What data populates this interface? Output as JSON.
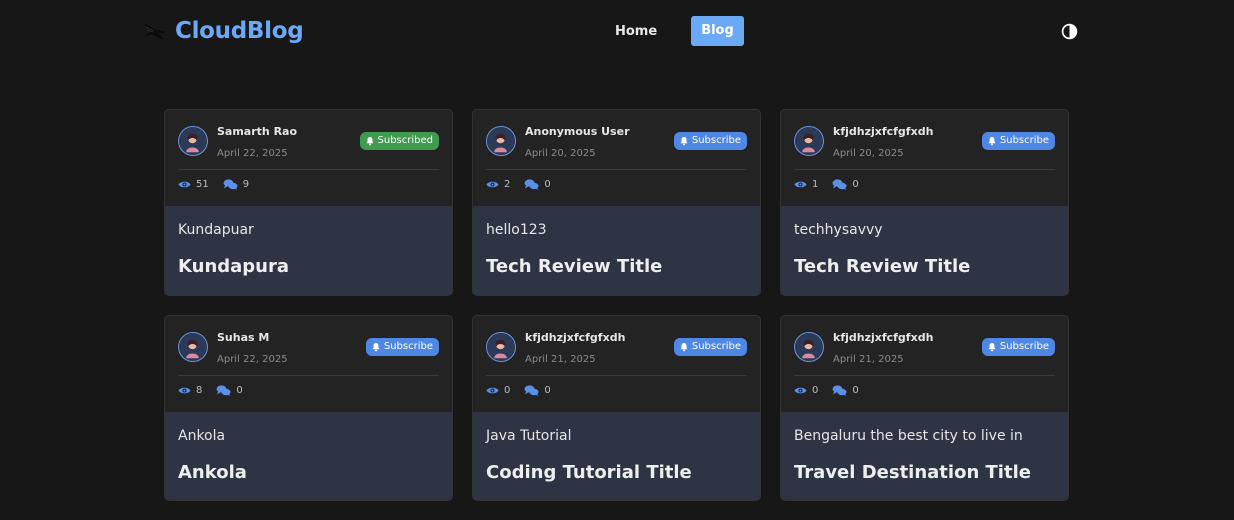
{
  "brand": {
    "name": "CloudBlog",
    "logo_icon": "bird-logo-icon"
  },
  "nav": {
    "home_label": "Home",
    "blog_label": "Blog",
    "theme_icon": "theme-toggle-icon"
  },
  "colors": {
    "accent": "#6aa9f5",
    "subscribe": "#4f87e5",
    "subscribed": "#3f9c4e",
    "card_body": "#2e3443",
    "background": "#171717"
  },
  "posts": [
    {
      "author": "Samarth Rao",
      "date": "April 22, 2025",
      "subscribe_label": "Subscribed",
      "subscribed": true,
      "views": "51",
      "comments": "9",
      "subtitle": "Kundapuar",
      "title": "Kundapura"
    },
    {
      "author": "Anonymous User",
      "date": "April 20, 2025",
      "subscribe_label": "Subscribe",
      "subscribed": false,
      "views": "2",
      "comments": "0",
      "subtitle": "hello123",
      "title": "Tech Review Title"
    },
    {
      "author": "kfjdhzjxfcfgfxdh",
      "date": "April 20, 2025",
      "subscribe_label": "Subscribe",
      "subscribed": false,
      "views": "1",
      "comments": "0",
      "subtitle": "techhysavvy",
      "title": "Tech Review Title"
    },
    {
      "author": "Suhas M",
      "date": "April 22, 2025",
      "subscribe_label": "Subscribe",
      "subscribed": false,
      "views": "8",
      "comments": "0",
      "subtitle": "Ankola",
      "title": "Ankola"
    },
    {
      "author": "kfjdhzjxfcfgfxdh",
      "date": "April 21, 2025",
      "subscribe_label": "Subscribe",
      "subscribed": false,
      "views": "0",
      "comments": "0",
      "subtitle": "Java Tutorial",
      "title": "Coding Tutorial Title"
    },
    {
      "author": "kfjdhzjxfcfgfxdh",
      "date": "April 21, 2025",
      "subscribe_label": "Subscribe",
      "subscribed": false,
      "views": "0",
      "comments": "0",
      "subtitle": "Bengaluru the best city to live in",
      "title": "Travel Destination Title"
    }
  ]
}
